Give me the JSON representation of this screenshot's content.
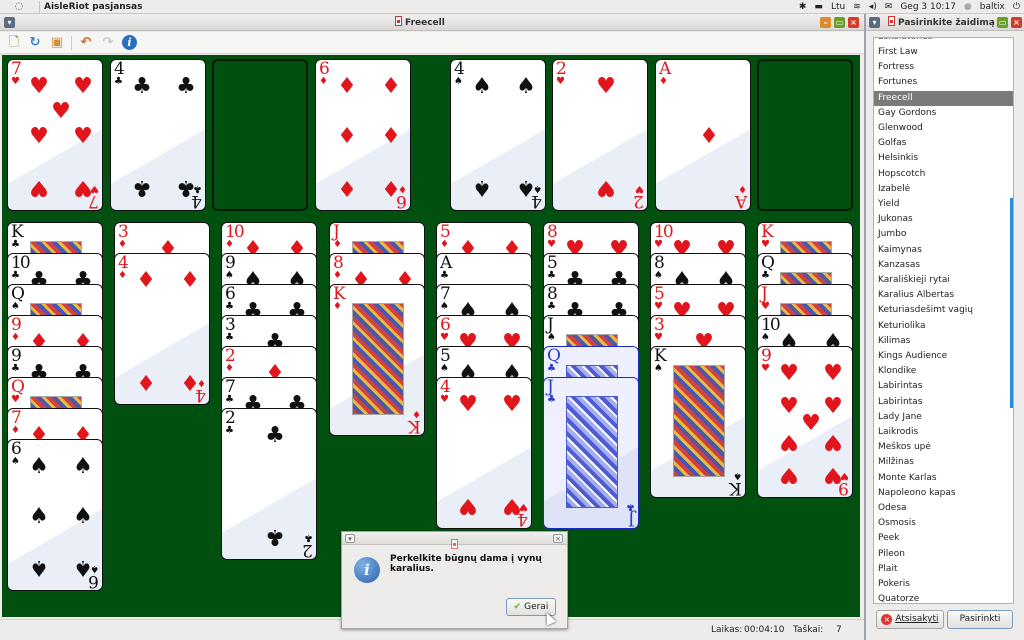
{
  "top_panel": {
    "app_name": "AisleRiot pasjansas",
    "keyboard_layout": "Ltu",
    "datetime": "Geg 3 10:17",
    "user": "baltix"
  },
  "main_window": {
    "title": "Freecell",
    "toolbar": {
      "new_game": "new-game",
      "restart": "restart",
      "select_game": "select-game",
      "undo": "undo",
      "redo": "redo",
      "help": "info"
    },
    "status": {
      "time_label": "Laikas:",
      "time_value": "00:04:10",
      "score_label": "Taškai:",
      "score_value": "7"
    }
  },
  "game": {
    "freecells": [
      {
        "rank": "7",
        "suit": "♥",
        "color": "red"
      },
      {
        "rank": "4",
        "suit": "♣",
        "color": "black"
      },
      null,
      {
        "rank": "6",
        "suit": "♦",
        "color": "red"
      }
    ],
    "foundations": [
      {
        "rank": "4",
        "suit": "♠",
        "color": "black"
      },
      {
        "rank": "2",
        "suit": "♥",
        "color": "red"
      },
      {
        "rank": "A",
        "suit": "♦",
        "color": "red"
      },
      null
    ],
    "tableau": [
      [
        {
          "rank": "K",
          "suit": "♣",
          "color": "black"
        },
        {
          "rank": "10",
          "suit": "♣",
          "color": "black"
        },
        {
          "rank": "Q",
          "suit": "♠",
          "color": "black"
        },
        {
          "rank": "9",
          "suit": "♦",
          "color": "red"
        },
        {
          "rank": "9",
          "suit": "♣",
          "color": "black"
        },
        {
          "rank": "Q",
          "suit": "♥",
          "color": "red"
        },
        {
          "rank": "7",
          "suit": "♦",
          "color": "red"
        },
        {
          "rank": "6",
          "suit": "♠",
          "color": "black"
        }
      ],
      [
        {
          "rank": "3",
          "suit": "♦",
          "color": "red"
        },
        {
          "rank": "4",
          "suit": "♦",
          "color": "red"
        }
      ],
      [
        {
          "rank": "10",
          "suit": "♦",
          "color": "red"
        },
        {
          "rank": "9",
          "suit": "♠",
          "color": "black"
        },
        {
          "rank": "6",
          "suit": "♣",
          "color": "black"
        },
        {
          "rank": "3",
          "suit": "♣",
          "color": "black"
        },
        {
          "rank": "2",
          "suit": "♦",
          "color": "red"
        },
        {
          "rank": "7",
          "suit": "♣",
          "color": "black"
        },
        {
          "rank": "2",
          "suit": "♣",
          "color": "black"
        }
      ],
      [
        {
          "rank": "J",
          "suit": "♦",
          "color": "red"
        },
        {
          "rank": "8",
          "suit": "♦",
          "color": "red"
        },
        {
          "rank": "K",
          "suit": "♦",
          "color": "red"
        }
      ],
      [
        {
          "rank": "5",
          "suit": "♦",
          "color": "red"
        },
        {
          "rank": "A",
          "suit": "♣",
          "color": "black"
        },
        {
          "rank": "7",
          "suit": "♠",
          "color": "black"
        },
        {
          "rank": "6",
          "suit": "♥",
          "color": "red"
        },
        {
          "rank": "5",
          "suit": "♠",
          "color": "black"
        },
        {
          "rank": "4",
          "suit": "♥",
          "color": "red"
        }
      ],
      [
        {
          "rank": "8",
          "suit": "♥",
          "color": "red"
        },
        {
          "rank": "5",
          "suit": "♣",
          "color": "black"
        },
        {
          "rank": "8",
          "suit": "♣",
          "color": "black"
        },
        {
          "rank": "J",
          "suit": "♠",
          "color": "black"
        },
        {
          "rank": "Q",
          "suit": "♣",
          "color": "black",
          "highlighted": true
        },
        {
          "rank": "J",
          "suit": "♣",
          "color": "black",
          "highlighted": true
        }
      ],
      [
        {
          "rank": "10",
          "suit": "♥",
          "color": "red"
        },
        {
          "rank": "8",
          "suit": "♠",
          "color": "black"
        },
        {
          "rank": "5",
          "suit": "♥",
          "color": "red"
        },
        {
          "rank": "3",
          "suit": "♥",
          "color": "red"
        },
        {
          "rank": "K",
          "suit": "♠",
          "color": "black"
        }
      ],
      [
        {
          "rank": "K",
          "suit": "♥",
          "color": "red"
        },
        {
          "rank": "Q",
          "suit": "♣",
          "color": "black"
        },
        {
          "rank": "J",
          "suit": "♥",
          "color": "red"
        },
        {
          "rank": "10",
          "suit": "♠",
          "color": "black"
        },
        {
          "rank": "9",
          "suit": "♥",
          "color": "red"
        }
      ]
    ]
  },
  "hint_dialog": {
    "message": "Perkelkite būgnų dama į vynų karalius.",
    "ok_label": "Gerai"
  },
  "select_game_dialog": {
    "title": "Pasirinkite žaidimą",
    "partial_top_item": "Eskalatorius",
    "items": [
      "First Law",
      "Fortress",
      "Fortunes",
      "Freecell",
      "Gay Gordons",
      "Glenwood",
      "Golfas",
      "Helsinkis",
      "Hopscotch",
      "Izabelė",
      "Yield",
      "Jukonas",
      "Jumbo",
      "Kaimynas",
      "Kanzasas",
      "Karališkieji rytai",
      "Karalius Albertas",
      "Keturiasdešimt vagių",
      "Keturiolika",
      "Kilimas",
      "Kings Audience",
      "Klondike",
      "Labirintas",
      "Labirintas",
      "Lady Jane",
      "Laikrodis",
      "Meškos upė",
      "Milžinas",
      "Monte Karlas",
      "Napoleono kapas",
      "Odesa",
      "Osmosis",
      "Peek",
      "Pileon",
      "Plait",
      "Pokeris",
      "Quatorze"
    ],
    "selected": "Freecell",
    "cancel_label": "Atsisakyti",
    "select_label": "Pasirinkti"
  }
}
